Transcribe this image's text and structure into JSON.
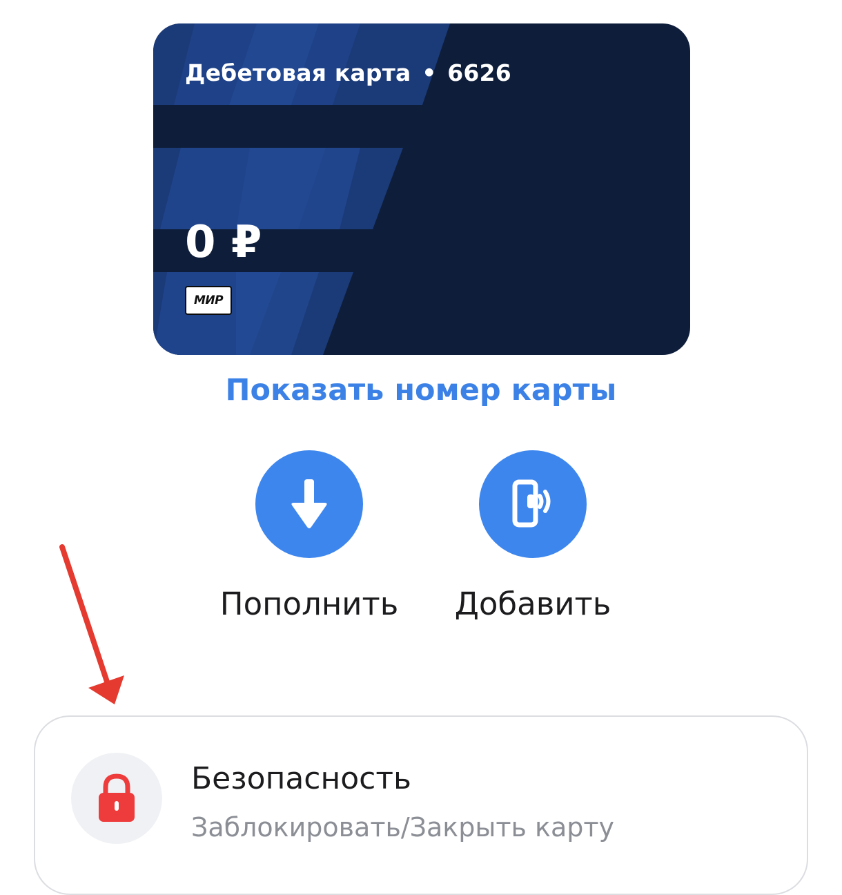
{
  "card": {
    "type_label": "Дебетовая карта",
    "separator": "•",
    "last_digits": "6626",
    "balance": "0 ₽",
    "payment_system": "МИР"
  },
  "show_card_number": "Показать номер карты",
  "actions": [
    {
      "label": "Пополнить",
      "icon": "arrow-down-icon"
    },
    {
      "label": "Добавить",
      "icon": "contactless-phone-icon"
    }
  ],
  "security": {
    "title": "Безопасность",
    "subtitle": "Заблокировать/Закрыть карту",
    "icon": "lock-icon"
  },
  "colors": {
    "accent": "#3d86ee",
    "link": "#3c82e6",
    "card_background": "#0e1e3a",
    "lock": "#ee3b3b",
    "annotation_arrow": "#e53a2f"
  }
}
